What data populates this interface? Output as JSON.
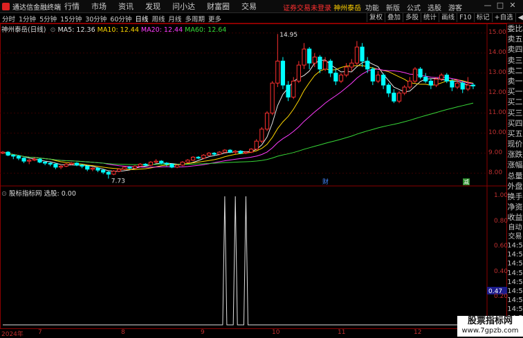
{
  "app": {
    "logo_text": "通达信金融终端",
    "menu": [
      "行情",
      "市场",
      "资讯",
      "发现",
      "问小达",
      "财富圈",
      "交易"
    ],
    "notice_red": "证券交易未登录",
    "notice_yellow": "神州泰岳",
    "right_menu": [
      "功能",
      "新版",
      "公式",
      "选股"
    ],
    "user": "游客",
    "window_buttons": [
      "—",
      "□",
      "✕"
    ]
  },
  "toolbar": {
    "periods": [
      "分时",
      "1分钟",
      "5分钟",
      "15分钟",
      "30分钟",
      "60分钟",
      "日线",
      "周线",
      "月线",
      "多周期",
      "更多"
    ],
    "active_period": "日线",
    "right_tools": [
      "复权",
      "叠加",
      "多股",
      "统计",
      "画线",
      "F10",
      "标记",
      "+自选",
      "◀"
    ]
  },
  "main_chart": {
    "stock_name": "神州泰岳(日线)",
    "ma5_label": "MA5: 12.36",
    "ma10_label": "MA10: 12.44",
    "ma20_label": "MA20: 12.44",
    "ma60_label": "MA60: 12.64",
    "high_label": "14.95",
    "low_label": "7.73",
    "marker_cai": "财",
    "marker_jian": "减",
    "colors": {
      "up": "#ff3030",
      "down": "#00ffff",
      "ma5": "#e8e8e8",
      "ma10": "#ffd700",
      "ma20": "#ff3cff",
      "ma60": "#38d838",
      "axis": "#c03030"
    }
  },
  "price_axis": [
    "15.00",
    "14.00",
    "13.00",
    "12.00",
    "11.00",
    "10.00",
    "9.00",
    "8.00"
  ],
  "indicator": {
    "title": "股标指标网 选股: 0.00",
    "axis": [
      "1.00",
      "0.80",
      "0.60",
      "0.40",
      "0.20",
      "0.00"
    ],
    "current_value": "0.47"
  },
  "side_panel": [
    "委比",
    "卖五",
    "卖四",
    "卖三",
    "卖二",
    "卖一",
    "买一",
    "买二",
    "买三",
    "买四",
    "买五",
    "现价",
    "涨跌",
    "涨幅",
    "总量",
    "外盘",
    "换手",
    "净资",
    "收益"
  ],
  "side_panel_lower": [
    "自动",
    "交易",
    "14:5",
    "14:5",
    "14:5",
    "14:5",
    "14:5",
    "14:5",
    "14:5",
    "14:5",
    "14:5"
  ],
  "dates": [
    "2024年",
    "7",
    "8",
    "9",
    "10",
    "11",
    "12"
  ],
  "watermark": {
    "line1": "股票指标网",
    "line2": "www.7gpzb.com"
  },
  "chart_data": {
    "type": "candlestick",
    "ylim": [
      7.5,
      15.2
    ],
    "candles": [
      [
        9.0,
        9.05,
        8.95,
        9.1
      ],
      [
        9.05,
        8.9,
        8.85,
        9.1
      ],
      [
        8.9,
        8.85,
        8.7,
        8.95
      ],
      [
        8.85,
        8.75,
        8.65,
        8.9
      ],
      [
        8.75,
        8.6,
        8.5,
        8.8
      ],
      [
        8.6,
        8.65,
        8.45,
        8.7
      ],
      [
        8.65,
        8.7,
        8.6,
        8.8
      ],
      [
        8.7,
        8.55,
        8.5,
        8.75
      ],
      [
        8.55,
        8.5,
        8.4,
        8.6
      ],
      [
        8.5,
        8.45,
        8.35,
        8.55
      ],
      [
        8.45,
        8.3,
        8.2,
        8.5
      ],
      [
        8.3,
        8.35,
        8.2,
        8.4
      ],
      [
        8.35,
        8.45,
        8.3,
        8.5
      ],
      [
        8.45,
        8.5,
        8.4,
        8.55
      ],
      [
        8.5,
        8.4,
        8.35,
        8.55
      ],
      [
        8.4,
        8.35,
        8.25,
        8.45
      ],
      [
        8.35,
        8.2,
        8.1,
        8.4
      ],
      [
        8.2,
        8.25,
        8.1,
        8.3
      ],
      [
        8.25,
        8.15,
        8.05,
        8.3
      ],
      [
        8.15,
        8.05,
        7.95,
        8.2
      ],
      [
        8.05,
        7.95,
        7.73,
        8.1
      ],
      [
        7.95,
        8.1,
        7.9,
        8.15
      ],
      [
        8.1,
        8.2,
        8.05,
        8.25
      ],
      [
        8.2,
        8.3,
        8.15,
        8.35
      ],
      [
        8.3,
        8.25,
        8.2,
        8.35
      ],
      [
        8.25,
        8.35,
        8.2,
        8.4
      ],
      [
        8.35,
        8.45,
        8.3,
        8.5
      ],
      [
        8.45,
        8.4,
        8.35,
        8.5
      ],
      [
        8.4,
        8.55,
        8.35,
        8.6
      ],
      [
        8.55,
        8.6,
        8.5,
        8.7
      ],
      [
        8.6,
        8.5,
        8.45,
        8.65
      ],
      [
        8.5,
        8.45,
        8.35,
        8.55
      ],
      [
        8.45,
        8.3,
        8.25,
        8.5
      ],
      [
        8.3,
        8.4,
        8.25,
        8.45
      ],
      [
        8.4,
        8.55,
        8.35,
        8.6
      ],
      [
        8.55,
        8.65,
        8.5,
        8.7
      ],
      [
        8.65,
        8.8,
        8.6,
        8.85
      ],
      [
        8.8,
        8.75,
        8.7,
        8.85
      ],
      [
        8.75,
        8.9,
        8.7,
        8.95
      ],
      [
        8.9,
        9.0,
        8.85,
        9.05
      ],
      [
        9.0,
        8.95,
        8.85,
        9.05
      ],
      [
        8.95,
        9.05,
        8.9,
        9.1
      ],
      [
        9.05,
        9.15,
        9.0,
        9.2
      ],
      [
        9.15,
        9.05,
        9.0,
        9.2
      ],
      [
        9.05,
        9.1,
        8.95,
        9.15
      ],
      [
        9.1,
        9.0,
        8.95,
        9.15
      ],
      [
        9.0,
        9.05,
        8.95,
        9.1
      ],
      [
        9.05,
        9.2,
        9.0,
        9.25
      ],
      [
        9.2,
        9.6,
        9.15,
        9.7
      ],
      [
        9.6,
        10.2,
        9.5,
        10.3
      ],
      [
        10.2,
        11.0,
        10.1,
        11.1
      ],
      [
        11.0,
        12.5,
        10.9,
        12.6
      ],
      [
        12.5,
        13.6,
        12.3,
        14.95
      ],
      [
        13.6,
        12.4,
        12.2,
        13.8
      ],
      [
        12.4,
        11.8,
        11.6,
        12.6
      ],
      [
        11.8,
        12.6,
        11.7,
        12.8
      ],
      [
        12.6,
        13.4,
        12.5,
        13.6
      ],
      [
        13.4,
        14.2,
        13.2,
        14.5
      ],
      [
        14.2,
        13.5,
        13.2,
        14.3
      ],
      [
        13.5,
        13.8,
        13.3,
        14.0
      ],
      [
        13.8,
        13.2,
        13.0,
        13.9
      ],
      [
        13.2,
        13.6,
        13.1,
        13.8
      ],
      [
        13.6,
        13.0,
        12.8,
        13.7
      ],
      [
        13.0,
        12.6,
        12.4,
        13.2
      ],
      [
        12.6,
        12.9,
        12.5,
        13.0
      ],
      [
        12.9,
        13.3,
        12.8,
        13.5
      ],
      [
        13.3,
        13.5,
        13.1,
        13.7
      ],
      [
        13.5,
        14.3,
        13.4,
        14.6
      ],
      [
        14.3,
        13.6,
        13.3,
        14.5
      ],
      [
        13.6,
        13.2,
        13.0,
        13.8
      ],
      [
        13.2,
        12.6,
        12.4,
        13.3
      ],
      [
        12.6,
        12.9,
        12.5,
        13.1
      ],
      [
        12.9,
        12.4,
        12.2,
        13.0
      ],
      [
        12.4,
        12.0,
        11.8,
        12.5
      ],
      [
        12.0,
        11.6,
        11.5,
        12.2
      ],
      [
        11.6,
        12.0,
        11.5,
        12.1
      ],
      [
        12.0,
        12.3,
        11.9,
        12.4
      ],
      [
        12.3,
        12.6,
        12.2,
        12.8
      ],
      [
        12.6,
        13.2,
        12.5,
        13.3
      ],
      [
        13.2,
        12.8,
        12.7,
        13.3
      ],
      [
        12.8,
        12.6,
        12.5,
        13.0
      ],
      [
        12.6,
        12.4,
        12.2,
        12.7
      ],
      [
        12.4,
        12.7,
        12.3,
        12.8
      ],
      [
        12.7,
        12.9,
        12.6,
        13.0
      ],
      [
        12.9,
        12.6,
        12.5,
        13.0
      ],
      [
        12.6,
        12.3,
        12.1,
        12.7
      ],
      [
        12.3,
        12.5,
        12.2,
        12.7
      ],
      [
        12.5,
        12.2,
        12.0,
        12.6
      ],
      [
        12.2,
        12.4,
        12.1,
        12.8
      ],
      [
        12.4,
        12.36,
        12.2,
        12.5
      ]
    ],
    "indicator_spikes": [
      42,
      44,
      46
    ],
    "indicator_length": 91
  }
}
